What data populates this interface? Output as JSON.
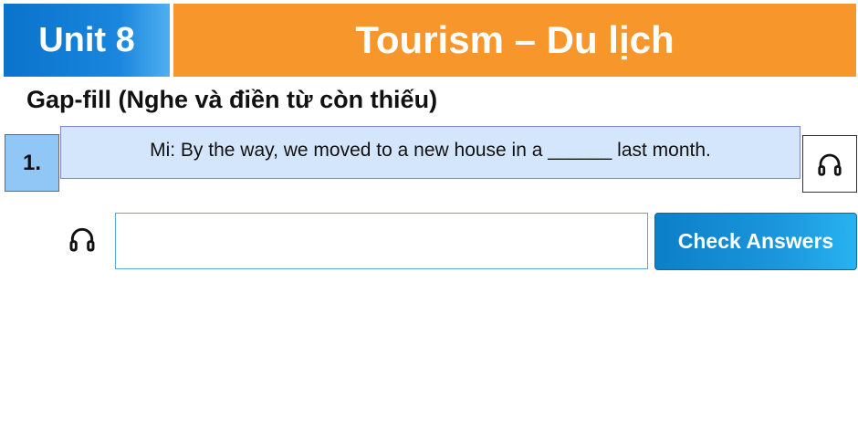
{
  "header": {
    "unit_label": "Unit 8",
    "title": "Tourism – Du lịch",
    "unit_color": "#0a73cc",
    "title_color": "#f7962a"
  },
  "exercise": {
    "subtitle": "Gap-fill (Nghe và điền từ còn thiếu)",
    "number": "1.",
    "question": "Mi: By the way, we moved to a new house in a ______ last month."
  },
  "answer": {
    "value": "",
    "placeholder": ""
  },
  "actions": {
    "check_label": "Check Answers",
    "audio_icon": "headphones-icon",
    "button_color": "#1b95dc"
  }
}
